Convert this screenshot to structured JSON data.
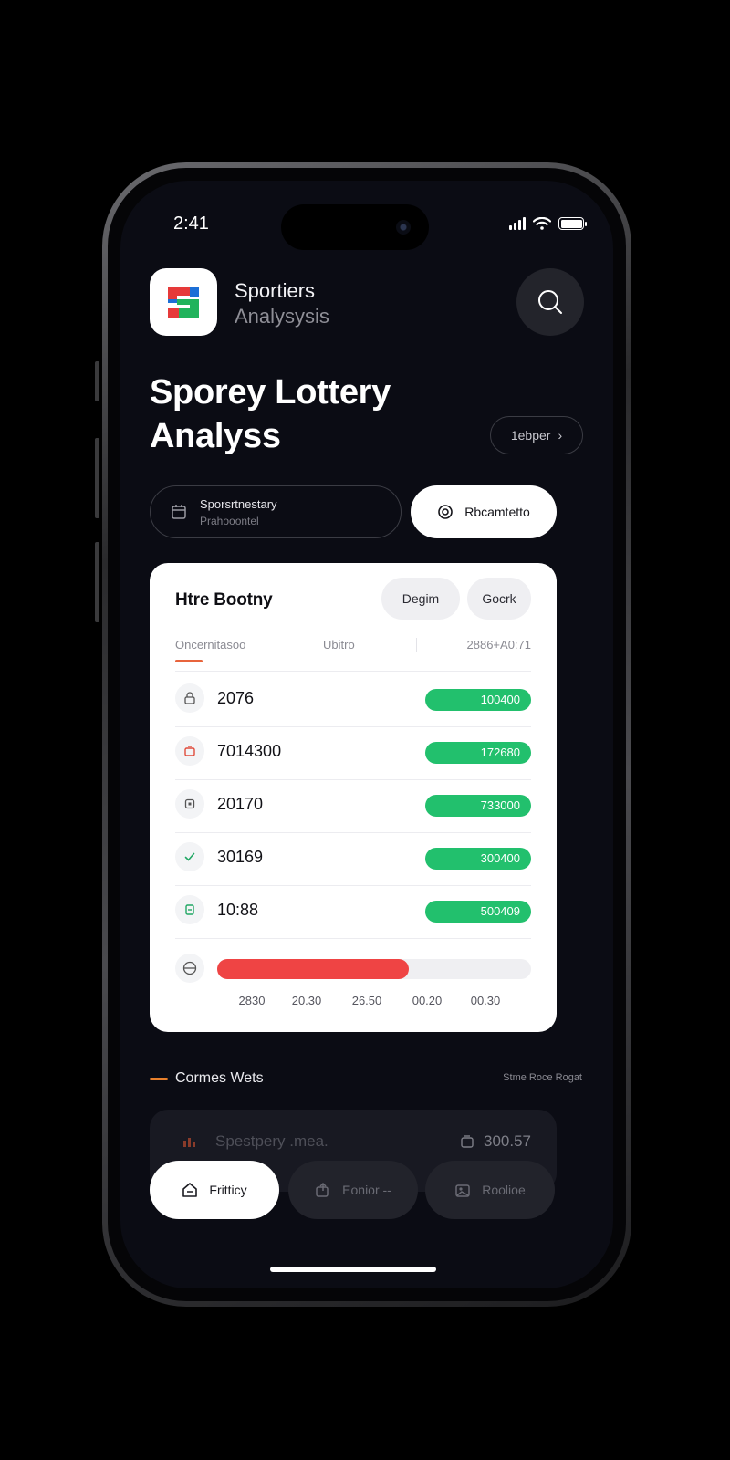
{
  "status_bar": {
    "time": "2:41"
  },
  "header": {
    "brand_name": "Sportiers",
    "brand_subtitle": "Analysysis"
  },
  "title": {
    "line1": "Sporey Lottery",
    "line2": "Analyss"
  },
  "pill_button": {
    "label": "1ebper"
  },
  "segment": {
    "left_title": "Sporsrtnestary",
    "left_subtitle": "Prahooontel",
    "right_label": "Rbcamtetto"
  },
  "card": {
    "title": "Htre Bootny",
    "chip_a": "Degim",
    "chip_b": "Gocrk",
    "columns": [
      "Oncernitasoo",
      "Ubitro",
      "2886+A0:71"
    ],
    "rows": [
      {
        "icon": "lock-icon",
        "value": "2076",
        "badge": "100400"
      },
      {
        "icon": "ticket-icon",
        "value": "7014300",
        "badge": "172680"
      },
      {
        "icon": "square-icon",
        "value": "20170",
        "badge": "733000"
      },
      {
        "icon": "check-icon",
        "value": "30169",
        "badge": "300400"
      },
      {
        "icon": "cash-icon",
        "value": "10:88",
        "badge": "500409"
      }
    ],
    "bar": {
      "icon": "globe-icon",
      "fill": 0.61
    },
    "ticks": [
      "2830",
      "20.30",
      "26.50",
      "00.20",
      "00.30"
    ]
  },
  "section": {
    "title": "Cormes Wets",
    "link": "Stme Roce Rogat"
  },
  "list_item": {
    "text": "Spestpery .mea.",
    "amount": "300.57"
  },
  "tabs": [
    {
      "label": "Fritticy",
      "icon": "home-icon"
    },
    {
      "label": "Eonior --",
      "icon": "share-icon"
    },
    {
      "label": "Roolioe",
      "icon": "image-icon"
    }
  ],
  "colors": {
    "accent_green": "#22c06d",
    "accent_red": "#ef4444",
    "accent_orange": "#e8802c",
    "background": "#0b0c14"
  }
}
